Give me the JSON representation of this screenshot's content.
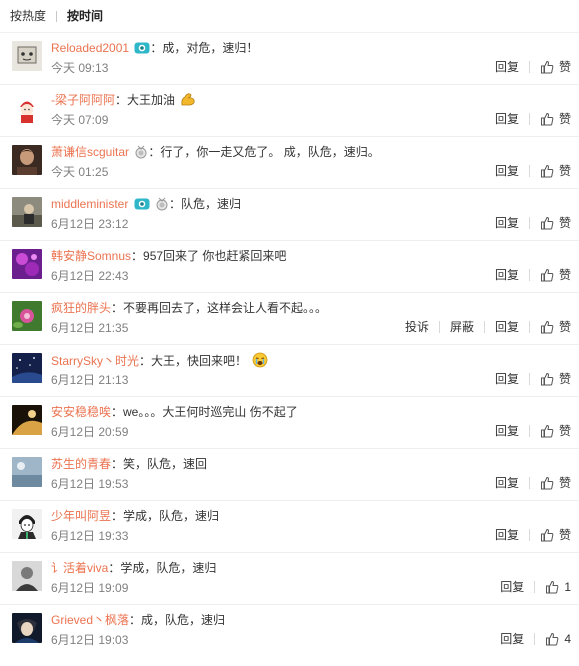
{
  "sort": {
    "hot_label": "按热度",
    "time_label": "按时间"
  },
  "actions": {
    "reply": "回复",
    "like": "赞",
    "report": "投诉",
    "block": "屏蔽"
  },
  "colors": {
    "username": "#eb7350",
    "time": "#808080",
    "text": "#333333"
  },
  "comments": [
    {
      "user": "Reloaded2001",
      "text": "：成，对危，速归！",
      "time": "今天 09:13",
      "like": "赞"
    },
    {
      "user": "-梁子阿阿阿",
      "text": "：大王加油",
      "time": "今天 07:09",
      "like": "赞"
    },
    {
      "user": "萧谦信scguitar",
      "text": "：行了，你一走又危了。 成，队危，速归。",
      "time": "今天 01:25",
      "like": "赞"
    },
    {
      "user": "middleminister",
      "text": "：队危，速归",
      "time": "6月12日 23:12",
      "like": "赞"
    },
    {
      "user": "韩安静Somnus",
      "text": "：957回来了 你也赶紧回来吧",
      "time": "6月12日 22:43",
      "like": "赞"
    },
    {
      "user": "疯狂的胖头",
      "text": "：不要再回去了，这样会让人看不起。。。",
      "time": "6月12日 21:35",
      "like": "赞"
    },
    {
      "user": "StarrySky丶时光",
      "text": "：大王，快回来吧！",
      "time": "6月12日 21:13",
      "like": "赞"
    },
    {
      "user": "安安稳稳唉",
      "text": "：we。。。大王何时巡完山 伤不起了",
      "time": "6月12日 20:59",
      "like": "赞"
    },
    {
      "user": "苏生的青春",
      "text": "：笑，队危，速回",
      "time": "6月12日 19:53",
      "like": "赞"
    },
    {
      "user": "少年叫阿昱",
      "text": "：学成，队危，速归",
      "time": "6月12日 19:33",
      "like": "赞"
    },
    {
      "user": "讠活着viva",
      "text": "：学成，队危，速归",
      "time": "6月12日 19:09",
      "like": "1"
    },
    {
      "user": "Grieved丶枫落",
      "text": "：成，队危，速归",
      "time": "6月12日 19:03",
      "like": "4"
    }
  ]
}
